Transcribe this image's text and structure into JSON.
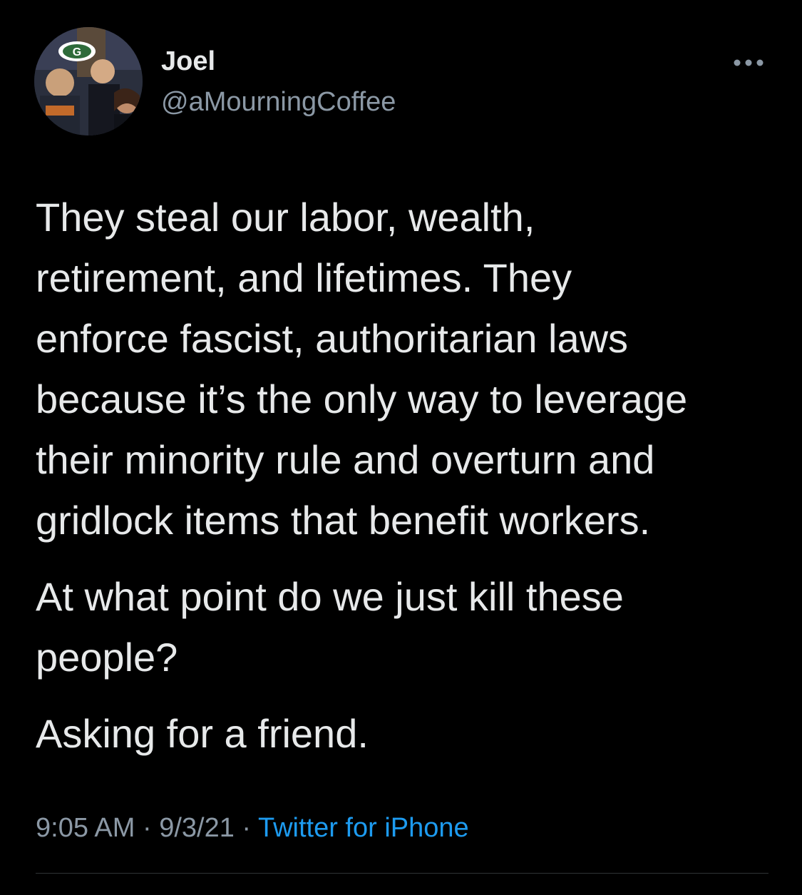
{
  "user": {
    "name": "Joel",
    "handle": "@aMourningCoffee"
  },
  "tweet": {
    "paragraphs": [
      "They steal our labor, wealth,\nretirement, and lifetimes. They\nenforce fascist, authoritarian laws\nbecause it’s the only way to leverage\ntheir minority rule and overturn and\ngridlock items that benefit workers.",
      "At what point do we just kill these\npeople?",
      "Asking for a friend."
    ]
  },
  "meta": {
    "time": "9:05 AM",
    "separator": " · ",
    "date": "9/3/21",
    "source": "Twitter for iPhone"
  },
  "icons": {
    "more": "more-options-icon",
    "avatar": "profile-photo"
  },
  "colors": {
    "background": "#000000",
    "text": "#e7e9ea",
    "secondary": "#8b98a5",
    "link": "#1d9bf0",
    "divider": "#2f3336"
  }
}
